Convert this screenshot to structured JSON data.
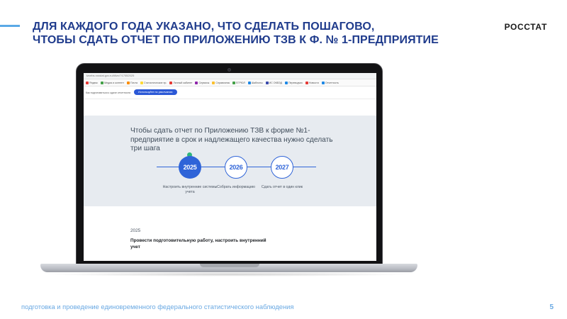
{
  "slide": {
    "title_line1": "ДЛЯ КАЖДОГО ГОДА УКАЗАНО, ЧТО СДЕЛАТЬ ПОШАГОВО,",
    "title_line2": "ЧТОБЫ СДАТЬ ОТЧЕТ ПО ПРИЛОЖЕНИЮ ТЗВ К Ф. № 1-ПРЕДПРИЯТИЕ",
    "brand": "РОССТАТ",
    "footer": "подготовка и проведение единовременного федерального статистического наблюдения",
    "page_number": "5",
    "accent_color": "#5aa9e6",
    "title_color": "#1f3b8c"
  },
  "browser": {
    "address": "tzvebs.rosstat.gov.ru/#/tzv/?17052025",
    "bookmarks": [
      {
        "label": "Яндекс",
        "icon": "yandex-icon",
        "color": "#e53935"
      },
      {
        "label": "Медиа и контент",
        "icon": "media-icon",
        "color": "#43a047"
      },
      {
        "label": "Почта",
        "icon": "mail-icon",
        "color": "#fb8c00"
      },
      {
        "label": "Статистические пр.",
        "icon": "folder-icon",
        "color": "#fdd835"
      },
      {
        "label": "Личный кабинет",
        "icon": "cabinet-icon",
        "color": "#e53935"
      },
      {
        "label": "Сервисы",
        "icon": "services-icon",
        "color": "#8e24aa"
      },
      {
        "label": "Справочник",
        "icon": "reference-icon",
        "color": "#fbc02d"
      },
      {
        "label": "ЕГРЮЛ",
        "icon": "egrul-icon",
        "color": "#43a047"
      },
      {
        "label": "Шаблоны",
        "icon": "templates-icon",
        "color": "#1e88e5"
      },
      {
        "label": "ИС ОКВЭД",
        "icon": "okved-icon",
        "color": "#3949ab"
      },
      {
        "label": "Переводчик",
        "icon": "translate-icon",
        "color": "#1e88e5"
      },
      {
        "label": "Новости",
        "icon": "news-icon",
        "color": "#e53935"
      },
      {
        "label": "Отчетность",
        "icon": "reports-icon",
        "color": "#1e88e5"
      }
    ]
  },
  "site": {
    "nav_link": "Как подготовиться к сдаче отчетности",
    "nav_button": "Используйте по умолчанию",
    "hero_title": "Чтобы сдать отчет по Приложению ТЗВ к форме №1-предприятие в срок и надлежащего качества нужно сделать три шага",
    "steps": [
      {
        "year": "2025",
        "label": "Настроить внутренние системы учета"
      },
      {
        "year": "2026",
        "label": "Собрать информацию"
      },
      {
        "year": "2027",
        "label": "Сдать отчет в один клик"
      }
    ],
    "section_year": "2025",
    "section_text": "Провести подготовительную работу, настроить внутренний учет",
    "accent_color": "#2f64d8",
    "hero_background": "#e7ebf0"
  }
}
